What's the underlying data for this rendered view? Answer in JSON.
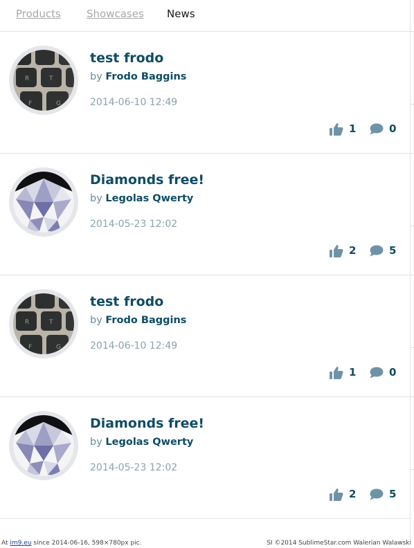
{
  "tabs": [
    {
      "label": "Products"
    },
    {
      "label": "Showcases"
    },
    {
      "label": "News"
    }
  ],
  "news": [
    {
      "title": "test frodo",
      "by": "by",
      "author": "Frodo Baggins",
      "date": "2014-06-10 12:49",
      "likes": "1",
      "comments": "0",
      "avatar": "keyboard-photo"
    },
    {
      "title": "Diamonds free!",
      "by": "by",
      "author": "Legolas Qwerty",
      "date": "2014-05-23 12:02",
      "likes": "2",
      "comments": "5",
      "avatar": "diamond-photo"
    },
    {
      "title": "test frodo",
      "by": "by",
      "author": "Frodo Baggins",
      "date": "2014-06-10 12:49",
      "likes": "1",
      "comments": "0",
      "avatar": "keyboard-photo"
    },
    {
      "title": "Diamonds free!",
      "by": "by",
      "author": "Legolas Qwerty",
      "date": "2014-05-23 12:02",
      "likes": "2",
      "comments": "5",
      "avatar": "diamond-photo"
    }
  ],
  "icons": {
    "like": "thumbs-up-icon",
    "comment": "comment-bubble-icon"
  },
  "colors": {
    "title": "#0f4c66",
    "meta": "#8aa3b0",
    "icon": "#6f93a6",
    "divider": "#e4e4e4"
  },
  "footer": {
    "prefix": "At",
    "link": "im9.eu",
    "since": "since 2014-06-16, 598×780px pic.",
    "credit": "SI ©2014 SublimeStar.com Walerian Walawski"
  }
}
